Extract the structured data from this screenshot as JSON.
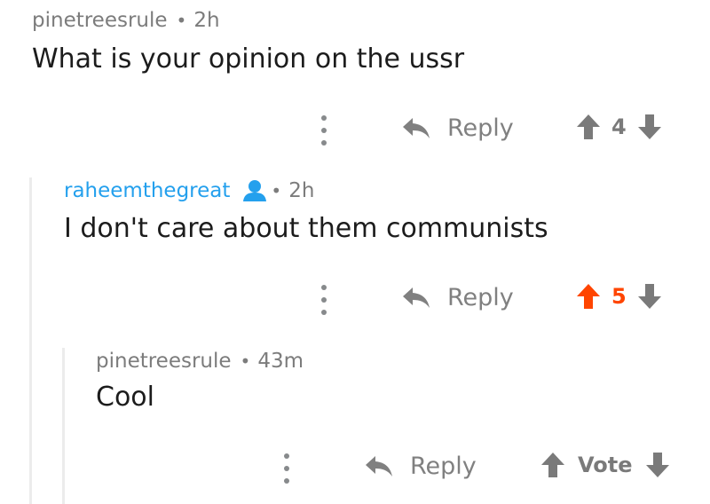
{
  "comments": [
    {
      "username": "pinetreesrule",
      "separator": "•",
      "time": "2h",
      "text": "What is your opinion on the ussr",
      "reply_label": "Reply",
      "vote_label": "4",
      "upvoted": false
    },
    {
      "username": "raheemthegreat",
      "separator": "•",
      "time": "2h",
      "text": "I don't care about them communists",
      "reply_label": "Reply",
      "vote_label": "5",
      "upvoted": true,
      "username_color": "#24a0ed"
    },
    {
      "username": "pinetreesrule",
      "separator": "•",
      "time": "43m",
      "text": "Cool",
      "reply_label": "Reply",
      "vote_label": "Vote",
      "upvoted": false
    }
  ],
  "colors": {
    "upvote": "#ff4500",
    "icon_gray": "#7a7a7a",
    "link_blue": "#24a0ed"
  },
  "icons": [
    "more-options-icon",
    "reply-icon",
    "upvote-icon",
    "downvote-icon",
    "user-icon"
  ]
}
